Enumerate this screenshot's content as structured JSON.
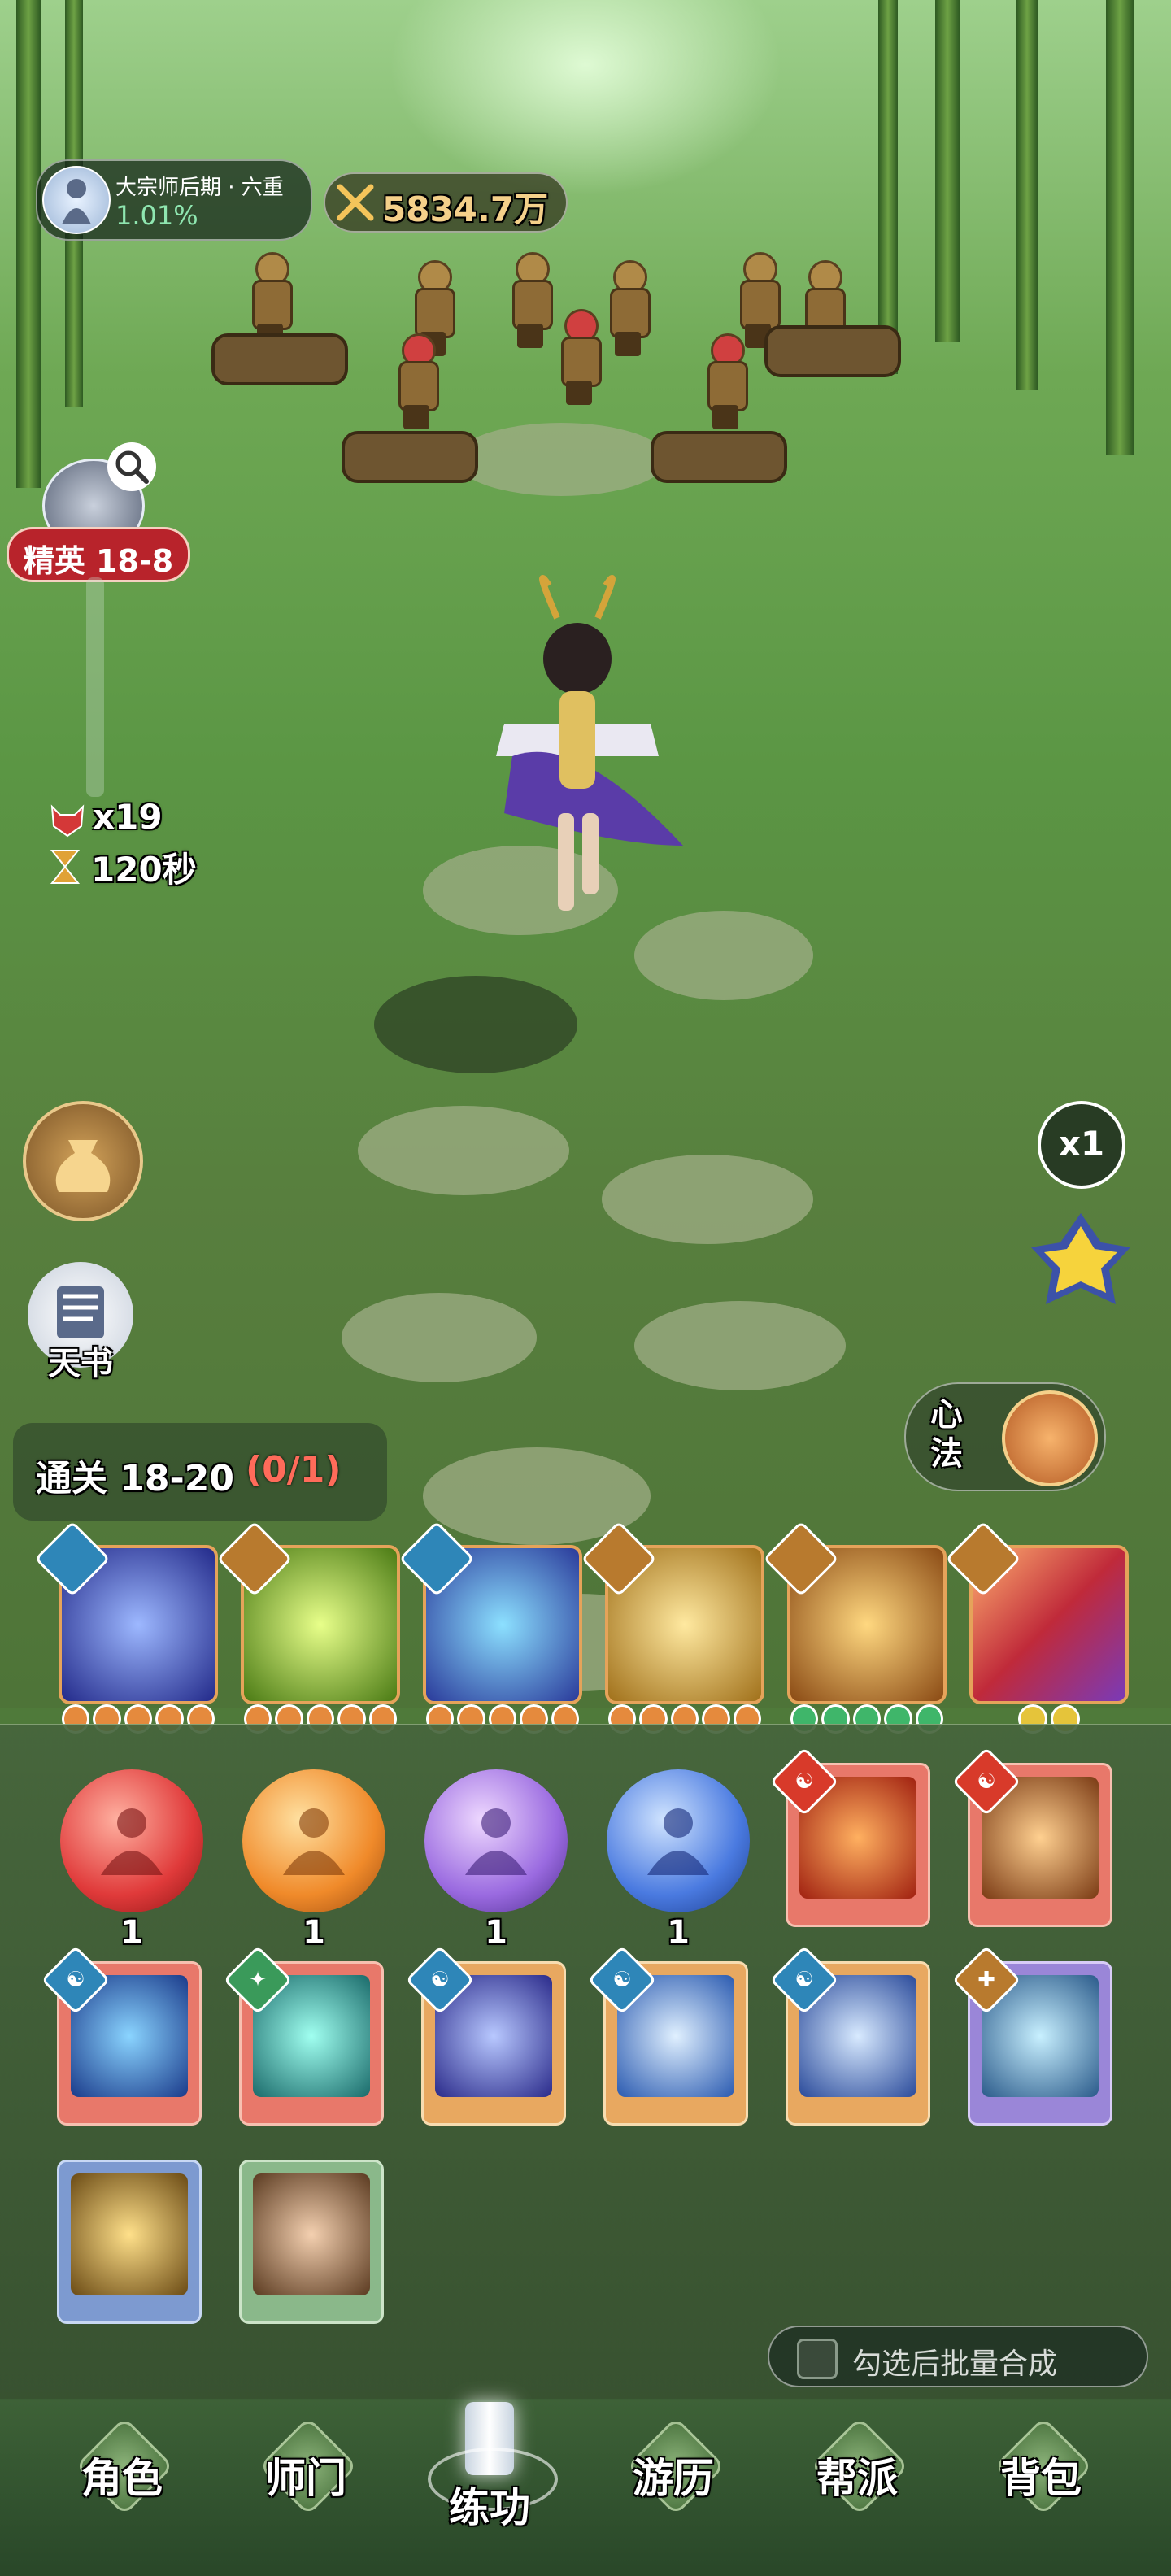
{
  "hud": {
    "realm_title": "大宗师后期 · 六重",
    "realm_progress": "1.01%",
    "power_value": "5834.7万",
    "stage_label": "精英 18-8",
    "kill_count": "x19",
    "timer": "120秒"
  },
  "left_buttons": {
    "book_label": "天书"
  },
  "right_buttons": {
    "speed_label": "x1",
    "heart_method_label": "心法"
  },
  "quest": {
    "prefix": "通关 18-20",
    "progress": "(0/1)"
  },
  "equipped_skills": [
    {
      "icon": "blue-orb-skill-icon",
      "badge": "taiji",
      "pips_color": "#e58a3d"
    },
    {
      "icon": "green-wind-skill-icon",
      "badge": "sword",
      "pips_color": "#e58a3d"
    },
    {
      "icon": "crystal-blocks-skill-icon",
      "badge": "taiji",
      "pips_color": "#e58a3d"
    },
    {
      "icon": "golden-blade-skill-icon",
      "badge": "sword",
      "pips_color": "#e58a3d"
    },
    {
      "icon": "golden-spear-skill-icon",
      "badge": "sword",
      "pips_color": "#3fb66a"
    },
    {
      "icon": "comet-skill-icon",
      "badge": "sword",
      "pips_color": "#e5c43a"
    }
  ],
  "inventory": {
    "orbs": [
      {
        "color": "red",
        "count": "1"
      },
      {
        "color": "orange",
        "count": "1"
      },
      {
        "color": "purple",
        "count": "1"
      },
      {
        "color": "blue",
        "count": "1"
      }
    ],
    "batch_merge_label": "勾选后批量合成"
  },
  "nav": {
    "items": [
      "角色",
      "师门",
      "练功",
      "游历",
      "帮派",
      "背包"
    ]
  },
  "colors": {
    "accent_gold": "#f4d08a",
    "quest_progress": "#ff6b5a",
    "card_red": "#e8786a",
    "card_orange": "#e8a860",
    "card_purple": "#9a86d8",
    "card_blue": "#7d9ad0",
    "card_green": "#8ab88a"
  }
}
